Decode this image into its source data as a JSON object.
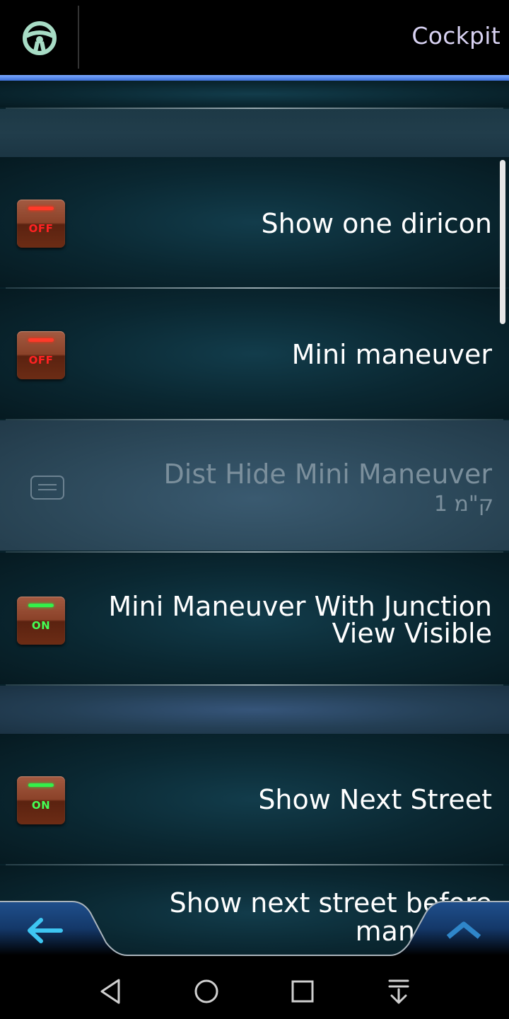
{
  "header": {
    "title": "Cockpit",
    "icon": "steering-wheel-icon"
  },
  "rows": [
    {
      "label": "Show one diricon",
      "toggle": "OFF"
    },
    {
      "label": "Mini maneuver",
      "toggle": "OFF"
    },
    {
      "label": "Dist Hide Mini Maneuver",
      "value": "1 ק\"מ",
      "enabled": false
    },
    {
      "label_line1": "Mini Maneuver With Junction",
      "label_line2": "View Visible",
      "toggle": "ON"
    },
    {
      "label": "Show Next Street",
      "toggle": "ON"
    },
    {
      "label_line1": "Show next street before",
      "label_line2": "maneuver"
    }
  ],
  "bottom_bar": {
    "back_icon": "arrow-left-icon",
    "up_icon": "chevron-up-icon"
  },
  "system_nav": {
    "icons": [
      "back-triangle-icon",
      "home-circle-icon",
      "recents-square-icon",
      "notification-pull-icon"
    ]
  },
  "colors": {
    "accent_blue": "#4a7fe6",
    "toggle_on": "#34f04a",
    "toggle_off": "#ff3a2a"
  }
}
